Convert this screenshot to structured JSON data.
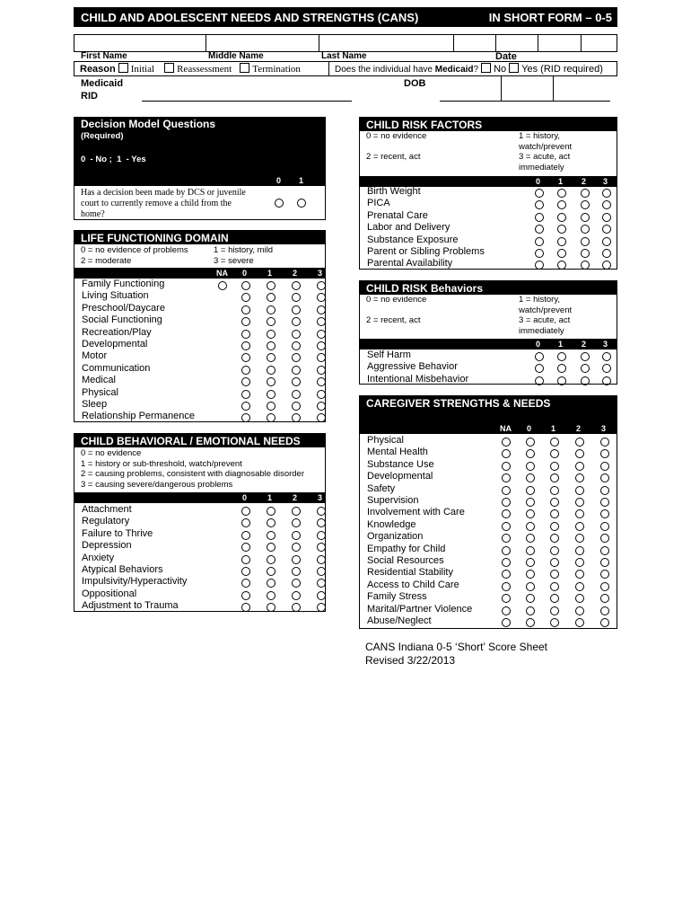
{
  "header": {
    "title": "CHILD AND ADOLESCENT NEEDS AND STRENGTHS (CANS)",
    "form": "IN SHORT FORM – 0-5"
  },
  "fields": {
    "first_name": "First Name",
    "middle_name": "Middle Name",
    "last_name": "Last Name",
    "date": "Date",
    "medicaid": "Medicaid",
    "rid": "RID",
    "dob": "DOB"
  },
  "reason": {
    "label": "Reason",
    "options": [
      "Initial",
      "Reassessment",
      "Termination"
    ],
    "medicaid_question": "Does the individual have ",
    "medicaid_word": "Medicaid",
    "q_mark": "?",
    "no": "No",
    "yes": "Yes (RID required)"
  },
  "decision": {
    "title": "Decision Model Questions",
    "required": "(Required)",
    "legend": "0  - No ;  1  - Yes",
    "columns": [
      "0",
      "1"
    ],
    "question": "Has a decision been made by DCS or juvenile court to currently remove a child from the home?"
  },
  "sections": {
    "life": {
      "title": "LIFE FUNCTIONING DOMAIN",
      "legend": [
        [
          "0 = no evidence of problems",
          "1 = history, mild"
        ],
        [
          "2 = moderate",
          "3 = severe"
        ]
      ],
      "columns": [
        "NA",
        "0",
        "1",
        "2",
        "3"
      ],
      "items": [
        "Family Functioning",
        "Living Situation",
        "Preschool/Daycare",
        "Social Functioning",
        "Recreation/Play",
        "Developmental",
        "Motor",
        "Communication",
        "Medical",
        "Physical",
        "Sleep",
        "Relationship Permanence"
      ]
    },
    "behavioral": {
      "title": "CHILD BEHAVIORAL / EMOTIONAL NEEDS",
      "legend": [
        [
          "0 = no evidence"
        ],
        [
          "1 = history or sub-threshold, watch/prevent"
        ],
        [
          "2 = causing problems, consistent with diagnosable disorder"
        ],
        [
          "3 = causing severe/dangerous problems"
        ]
      ],
      "columns": [
        "0",
        "1",
        "2",
        "3"
      ],
      "items": [
        "Attachment",
        "Regulatory",
        "Failure to Thrive",
        "Depression",
        "Anxiety",
        "Atypical Behaviors",
        "Impulsivity/Hyperactivity",
        "Oppositional",
        "Adjustment to Trauma"
      ]
    },
    "risk_factors": {
      "title": "CHILD RISK FACTORS",
      "legend": [
        [
          "0 = no evidence",
          "1 = history,"
        ],
        [
          "",
          "watch/prevent"
        ],
        [
          "2 = recent, act",
          "3 = acute, act"
        ],
        [
          "",
          "immediately"
        ]
      ],
      "columns": [
        "0",
        "1",
        "2",
        "3"
      ],
      "items": [
        "Birth Weight",
        "PICA",
        "Prenatal Care",
        "Labor and Delivery",
        "Substance Exposure",
        "Parent or Sibling Problems",
        "Parental Availability"
      ]
    },
    "risk_behaviors": {
      "title": "CHILD RISK Behaviors",
      "legend": [
        [
          "0 = no evidence",
          "1 = history,"
        ],
        [
          "",
          "watch/prevent"
        ],
        [
          "2 = recent, act",
          "3 = acute, act"
        ],
        [
          "",
          "immediately"
        ]
      ],
      "columns": [
        "0",
        "1",
        "2",
        "3"
      ],
      "items": [
        "Self Harm",
        "Aggressive Behavior",
        "Intentional Misbehavior"
      ]
    },
    "caregiver": {
      "title": "CAREGIVER STRENGTHS & NEEDS",
      "legend": [],
      "columns": [
        "NA",
        "0",
        "1",
        "2",
        "3"
      ],
      "items": [
        "Physical",
        "Mental Health",
        "Substance Use",
        "Developmental",
        "Safety",
        "Supervision",
        "Involvement with Care",
        "Knowledge",
        "Organization",
        "Empathy for Child",
        "Social Resources",
        "Residential Stability",
        "Access to Child Care",
        "Family Stress",
        "Marital/Partner Violence",
        "Abuse/Neglect"
      ]
    }
  },
  "footer": {
    "line1": "CANS Indiana 0-5 ‘Short’ Score Sheet",
    "line2": "Revised 3/22/2013"
  }
}
